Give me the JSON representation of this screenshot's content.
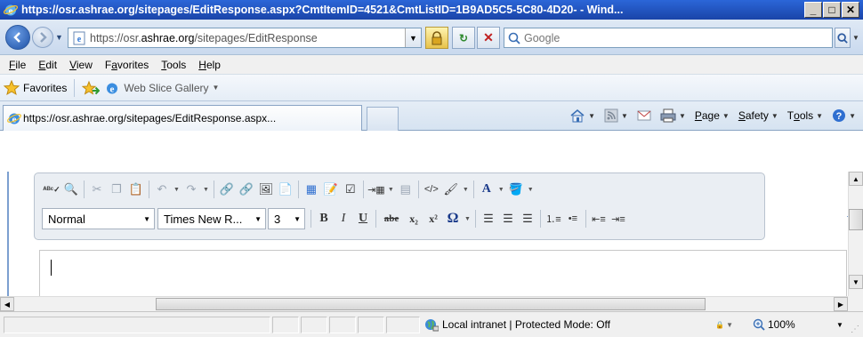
{
  "window": {
    "title": "https://osr.ashrae.org/sitepages/EditResponse.aspx?CmtItemID=4521&CmtListID=1B9AD5C5-5C80-4D20- - Wind...",
    "buttons": [
      "_",
      "□",
      "✕"
    ]
  },
  "address": {
    "url_prefix": "https://osr.",
    "url_domain": "ashrae.org",
    "url_path": "/sitepages/EditResponse"
  },
  "search": {
    "placeholder": "Google"
  },
  "menu": {
    "items": [
      {
        "key": "F",
        "rest": "ile"
      },
      {
        "key": "E",
        "rest": "dit"
      },
      {
        "key": "V",
        "rest": "iew"
      },
      {
        "pre": "F",
        "key": "a",
        "rest": "vorites"
      },
      {
        "key": "T",
        "rest": "ools"
      },
      {
        "key": "H",
        "rest": "elp"
      }
    ]
  },
  "favorites": {
    "label": "Favorites",
    "web_slice": "Web Slice Gallery"
  },
  "tab": {
    "title": "https://osr.ashrae.org/sitepages/EditResponse.aspx..."
  },
  "commands": {
    "page": {
      "key": "P",
      "rest": "age"
    },
    "safety": {
      "key": "S",
      "rest": "afety"
    },
    "tools": {
      "pre": "T",
      "key": "o",
      "rest": "ols"
    }
  },
  "editor_toolbar": {
    "style_value": "Normal",
    "font_value": "Times New R...",
    "size_value": "3",
    "bold": "B",
    "italic": "I",
    "underline": "U",
    "strike": "abe",
    "subscript": "x₂",
    "superscript": "x²",
    "omega": "Ω",
    "text_color": "A"
  },
  "status": {
    "zone": "Local intranet | Protected Mode: Off",
    "zoom": "100%"
  },
  "colors": {
    "titlebar": "#1a44a8",
    "accent_blue": "#7ca0d0"
  }
}
